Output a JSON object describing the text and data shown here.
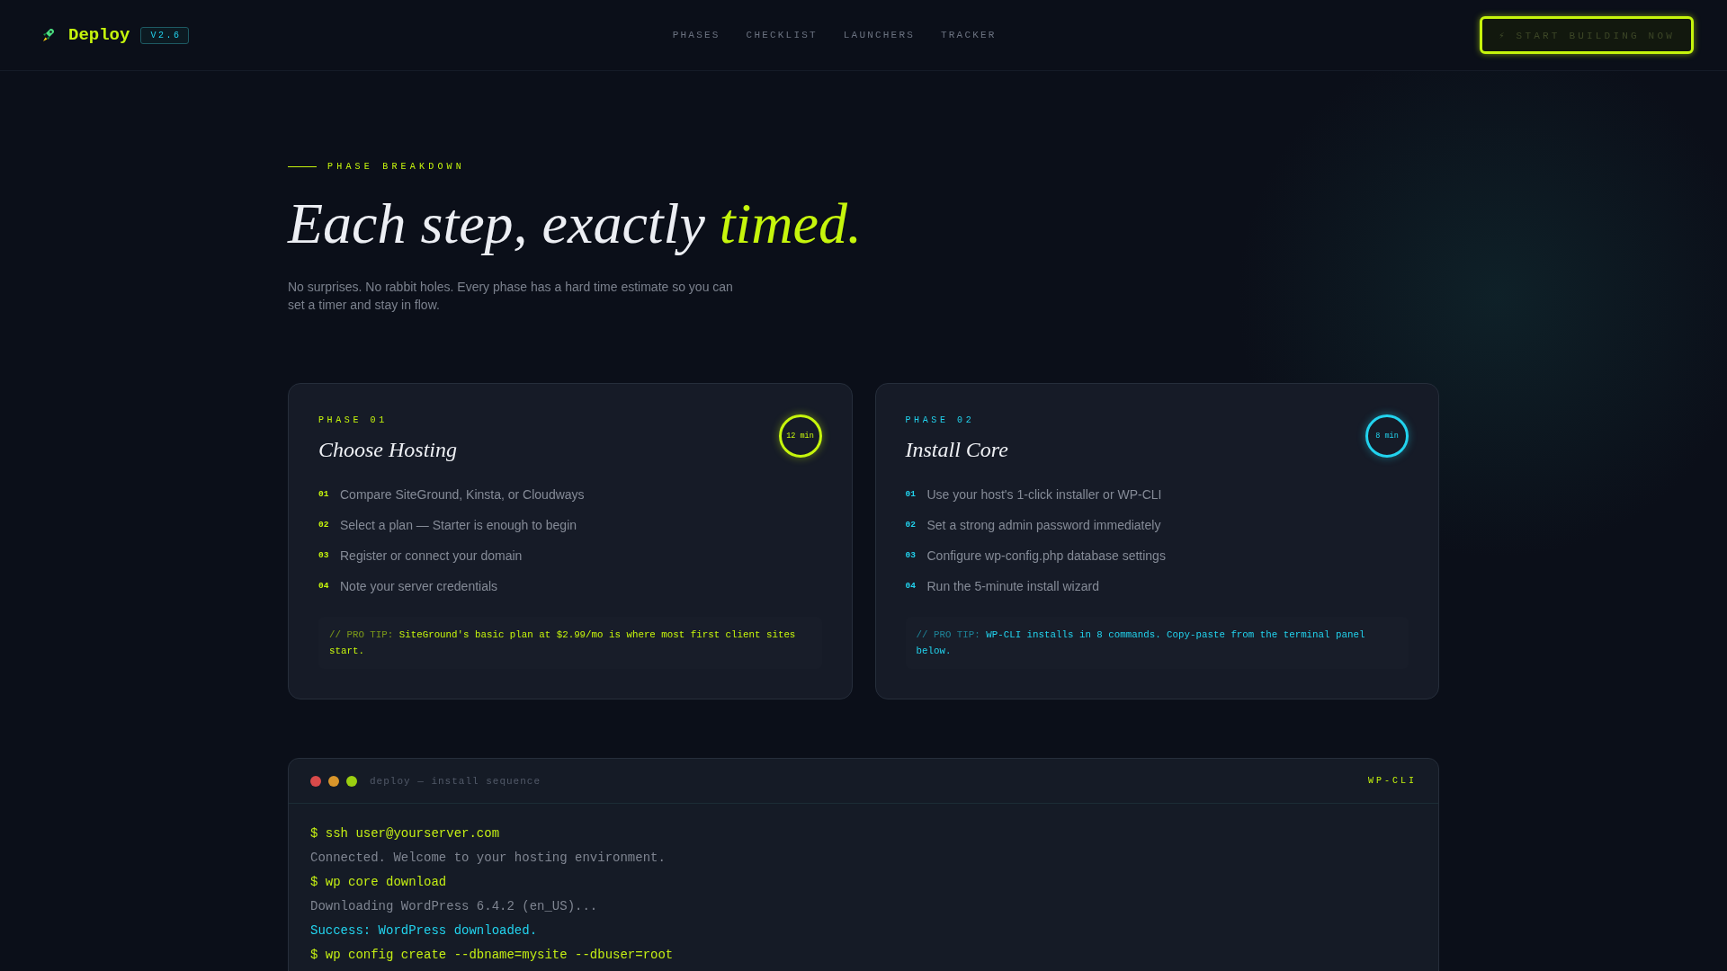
{
  "header": {
    "logo": {
      "name": "Deploy",
      "version": "V2.6"
    },
    "nav": [
      "PHASES",
      "CHECKLIST",
      "LAUNCHERS",
      "TRACKER"
    ],
    "cta": "⚡ START BUILDING NOW"
  },
  "hero": {
    "eyebrow": "PHASE BREAKDOWN",
    "heading": "Each step, exactly",
    "heading_accent": "timed.",
    "description": "No surprises. No rabbit holes. Every phase has a hard time estimate so you can set a timer and stay in flow."
  },
  "phases": [
    {
      "label": "PHASE 01",
      "title": "Choose Hosting",
      "duration": "12 min",
      "color": "#c6f50c",
      "steps": [
        {
          "number": "01",
          "text": "Compare SiteGround, Kinsta, or Cloudways"
        },
        {
          "number": "02",
          "text": "Select a plan — Starter is enough to begin"
        },
        {
          "number": "03",
          "text": "Register or connect your domain"
        },
        {
          "number": "04",
          "text": "Note your server credentials"
        }
      ],
      "tip_label": "// PRO TIP:",
      "tip": "SiteGround's basic plan at $2.99/mo is where most first client sites start."
    },
    {
      "label": "PHASE 02",
      "title": "Install Core",
      "duration": "8 min",
      "color": "#22d3ee",
      "steps": [
        {
          "number": "01",
          "text": "Use your host's 1-click installer or WP-CLI"
        },
        {
          "number": "02",
          "text": "Set a strong admin password immediately"
        },
        {
          "number": "03",
          "text": "Configure wp-config.php database settings"
        },
        {
          "number": "04",
          "text": "Run the 5-minute install wizard"
        }
      ],
      "tip_label": "// PRO TIP:",
      "tip": "WP-CLI installs in 8 commands. Copy-paste from the terminal panel below."
    }
  ],
  "terminal": {
    "title": "deploy — install sequence",
    "tag": "WP-CLI",
    "lines": [
      {
        "kind": "command",
        "text": "$ ssh user@yourserver.com"
      },
      {
        "kind": "output",
        "text": "Connected. Welcome to your hosting environment."
      },
      {
        "kind": "command",
        "text": "$ wp core download"
      },
      {
        "kind": "output",
        "text": "Downloading WordPress 6.4.2 (en_US)..."
      },
      {
        "kind": "success",
        "text": "Success: WordPress downloaded."
      },
      {
        "kind": "command",
        "text": "$ wp config create --dbname=mysite --dbuser=root"
      }
    ]
  }
}
